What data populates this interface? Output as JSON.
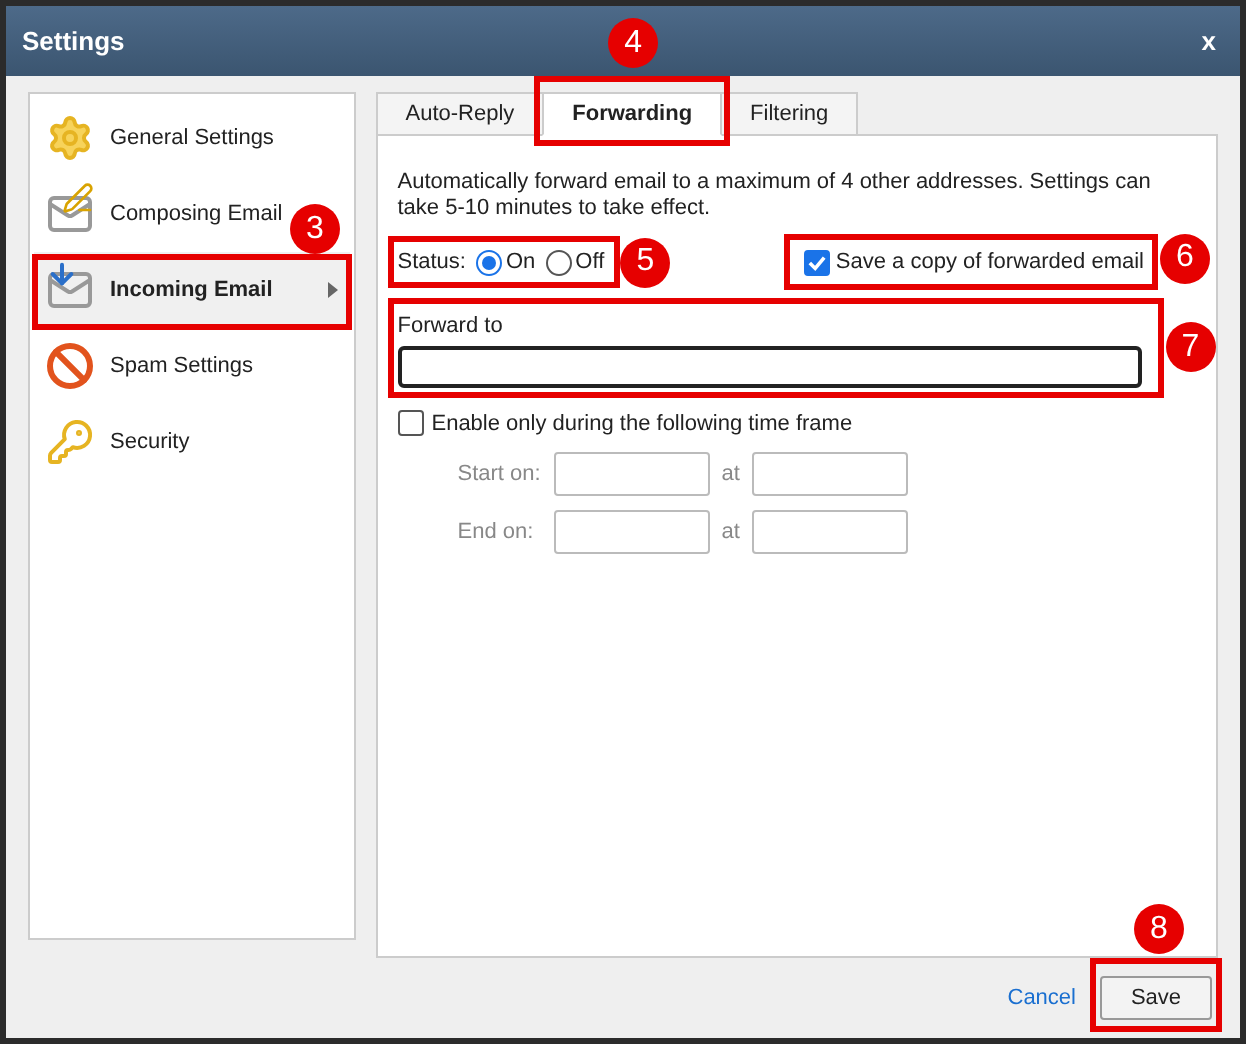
{
  "window": {
    "title": "Settings",
    "close": "x"
  },
  "sidebar": {
    "items": [
      {
        "label": "General Settings",
        "selected": false
      },
      {
        "label": "Composing Email",
        "selected": false
      },
      {
        "label": "Incoming Email",
        "selected": true
      },
      {
        "label": "Spam Settings",
        "selected": false
      },
      {
        "label": "Security",
        "selected": false
      }
    ]
  },
  "tabs": [
    {
      "label": "Auto-Reply",
      "selected": false
    },
    {
      "label": "Forwarding",
      "selected": true
    },
    {
      "label": "Filtering",
      "selected": false
    }
  ],
  "description": "Automatically forward email to a maximum of 4 other addresses. Settings can take 5-10 minutes to take effect.",
  "status": {
    "label": "Status:",
    "options": [
      {
        "label": "On",
        "selected": true
      },
      {
        "label": "Off",
        "selected": false
      }
    ]
  },
  "save_copy": {
    "label": "Save a copy of forwarded email",
    "checked": true
  },
  "forward_to": {
    "label": "Forward to"
  },
  "time_frame": {
    "label": "Enable only during the following time frame",
    "checked": false,
    "rows": [
      {
        "label": "Start on:",
        "at": "at"
      },
      {
        "label": "End on:",
        "at": "at"
      }
    ]
  },
  "buttons": {
    "cancel": "Cancel",
    "save": "Save"
  },
  "annotations": [
    {
      "number": "3"
    },
    {
      "number": "4"
    },
    {
      "number": "5"
    },
    {
      "number": "6"
    },
    {
      "number": "7"
    },
    {
      "number": "8"
    }
  ]
}
